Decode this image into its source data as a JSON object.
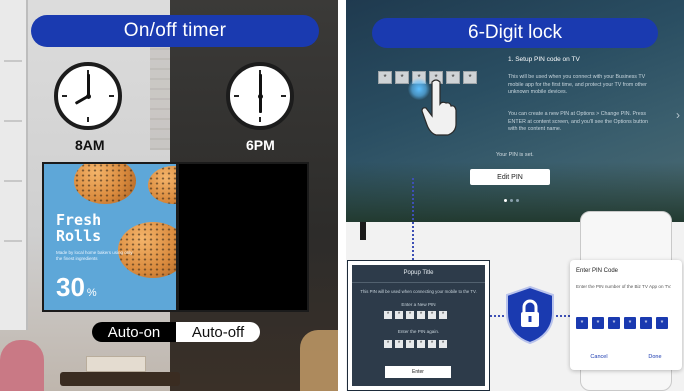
{
  "left_panel": {
    "title": "On/off timer",
    "clock_on_time": "8AM",
    "clock_off_time": "6PM",
    "ad": {
      "title_line1": "Fresh",
      "title_line2": "Rolls",
      "subtitle": "Made by local home bakers using only the finest ingredients",
      "percent_value": "30",
      "percent_sign": "%"
    },
    "toggle_on_label": "Auto-on",
    "toggle_off_label": "Auto-off"
  },
  "right_panel": {
    "title": "6-Digit lock",
    "tv_screen": {
      "pin_mask": [
        "*",
        "*",
        "*",
        "*",
        "*",
        "*"
      ],
      "heading": "1. Setup PIN code on TV",
      "text1": "This will be used when you connect with your Business TV mobile app for the first time, and protect your TV from other unknown mobile devices.",
      "text2": "You can create a new PIN at Options > Change PIN. Press ENTER at content screen, and you'll see the Options button with the content name.",
      "your_pin": "Your PIN is set.",
      "edit_pin_button": "Edit PIN"
    },
    "tv_popup": {
      "title": "Popup Title",
      "message": "This PIN will be used when connecting your mobile to the TV.",
      "enter_new_pin": "Enter a New PIN",
      "enter_again": "Enter the PIN again.",
      "pin_mask": [
        "*",
        "*",
        "*",
        "*",
        "*",
        "*"
      ],
      "enter_button": "Enter"
    },
    "phone_dialog": {
      "title": "Enter PIN Code",
      "description": "Enter the PIN number of the Biz TV App on TV.",
      "pin_mask": [
        "*",
        "*",
        "*",
        "*",
        "*",
        "*"
      ],
      "cancel": "Cancel",
      "done": "Done"
    }
  },
  "colors": {
    "brand_blue": "#1a3ab0",
    "tv_bg": "#2a4e62",
    "popup_bg": "#2d3b4a"
  }
}
